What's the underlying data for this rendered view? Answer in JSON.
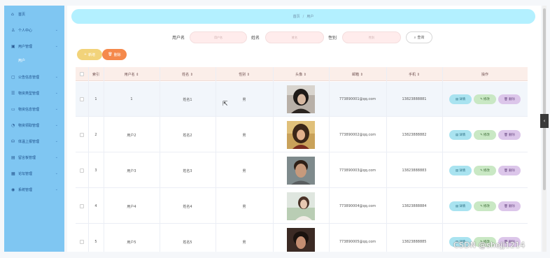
{
  "sidebar": {
    "items": [
      {
        "label": "首页",
        "icon": "home-icon",
        "glyph": "⌂"
      },
      {
        "label": "个人中心",
        "icon": "user-icon",
        "glyph": "♙"
      },
      {
        "label": "用户管理",
        "icon": "users-icon",
        "glyph": "▣"
      },
      {
        "label": "公告信息管理",
        "icon": "notice-icon",
        "glyph": "▢"
      },
      {
        "label": "物资类型管理",
        "icon": "category-icon",
        "glyph": "☰"
      },
      {
        "label": "物资信息管理",
        "icon": "info-icon",
        "glyph": "▭"
      },
      {
        "label": "物资领取管理",
        "icon": "receive-icon",
        "glyph": "◔"
      },
      {
        "label": "体温上报管理",
        "icon": "temperature-icon",
        "glyph": "⛁"
      },
      {
        "label": "留言板管理",
        "icon": "message-icon",
        "glyph": "▤"
      },
      {
        "label": "论坛管理",
        "icon": "forum-icon",
        "glyph": "▦"
      },
      {
        "label": "系统管理",
        "icon": "system-icon",
        "glyph": "◉"
      }
    ],
    "sub_item": "用户",
    "chevron": "⌄"
  },
  "breadcrumb": {
    "home": "首页",
    "separator": "/",
    "current": "用户"
  },
  "search": {
    "username_label": "用户名",
    "username_placeholder": "用户名",
    "name_label": "姓名",
    "name_placeholder": "姓名",
    "gender_label": "性别",
    "gender_placeholder": "性别",
    "button": "查询",
    "button_glyph": "⌕"
  },
  "actions": {
    "add": "新增",
    "add_glyph": "+",
    "delete": "删除",
    "delete_glyph": "🗑"
  },
  "table": {
    "headers": [
      "",
      "索引",
      "用户名 ⇕",
      "姓名 ⇕",
      "性别 ⇕",
      "头像 ⇕",
      "邮箱 ⇕",
      "手机 ⇕",
      "操作"
    ],
    "rows": [
      {
        "index": "1",
        "username": "1",
        "name": "姓名1",
        "gender": "男",
        "email": "773890001@qq.com",
        "phone": "13823888881"
      },
      {
        "index": "2",
        "username": "用户2",
        "name": "姓名2",
        "gender": "男",
        "email": "773890002@qq.com",
        "phone": "13823888882"
      },
      {
        "index": "3",
        "username": "用户3",
        "name": "姓名3",
        "gender": "男",
        "email": "773890003@qq.com",
        "phone": "13823888883"
      },
      {
        "index": "4",
        "username": "用户4",
        "name": "姓名4",
        "gender": "男",
        "email": "773890004@qq.com",
        "phone": "13823888884"
      },
      {
        "index": "5",
        "username": "用户5",
        "name": "姓名5",
        "gender": "男",
        "email": "773890005@qq.com",
        "phone": "13823888885"
      }
    ],
    "ops": {
      "detail": "详情",
      "detail_glyph": "▤",
      "edit": "修改",
      "edit_glyph": "✎",
      "delete": "删除",
      "delete_glyph": "🗑"
    }
  },
  "side_toggle": "‹",
  "watermark": "CSDN @shejj1214",
  "colors": {
    "sidebar": "#7fc6f2",
    "breadcrumb": "#b3f0ff",
    "add_button": "#f2d37a",
    "delete_button": "#f5894b",
    "table_header": "#fbeee9"
  }
}
